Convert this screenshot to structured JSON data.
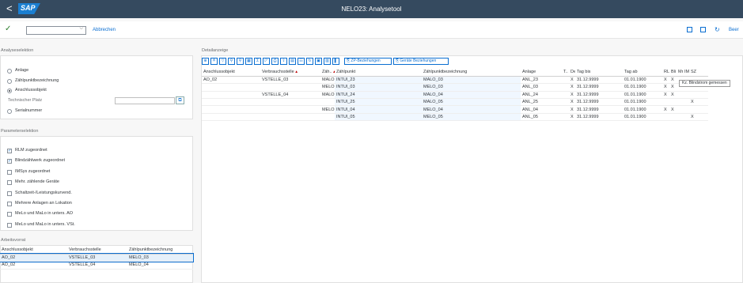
{
  "header": {
    "back": "<",
    "logo": "SAP",
    "title": "NELO23: Analysetool"
  },
  "toolbar": {
    "confirm": "✓",
    "command_value": "",
    "cancel_label": "Abbrechen",
    "right_label": "Beer"
  },
  "analyseselektion": {
    "title": "Analyseselektion",
    "options": [
      {
        "label": "Anlage",
        "selected": false
      },
      {
        "label": "Zählpunktbezeichnung",
        "selected": false
      },
      {
        "label": "Anschlussobjekt",
        "selected": true
      }
    ],
    "technischer_platz_label": "Technischer Platz",
    "technischer_platz_value": "",
    "serial_label": "Serialnummer"
  },
  "parameterselektion": {
    "title": "Parameterselektion",
    "checkboxes": [
      {
        "label": "RLM zugeordnet",
        "checked": true
      },
      {
        "label": "Blindzählwerk zugeordnet",
        "checked": true
      },
      {
        "label": "IMSys zugeordnet",
        "checked": false
      },
      {
        "label": "Mehr. zählende Geräte",
        "checked": false
      },
      {
        "label": "Schaltzeit-/Leistungskurvend.",
        "checked": false
      },
      {
        "label": "Mehrere Anlagen an Lokation",
        "checked": false
      },
      {
        "label": "MeLo und MaLo in unters. AO",
        "checked": false
      },
      {
        "label": "MeLo und MaLo in unters. VSt.",
        "checked": false
      }
    ]
  },
  "arbeitsvorrat": {
    "title": "Arbeitsvorrat",
    "columns": [
      "Anschlussobjekt",
      "Verbrauchsstelle",
      "Zählpunktbezeichnung"
    ],
    "rows": [
      [
        "AO_02",
        "VSTELLE_03",
        "MELO_03"
      ],
      [
        "AO_02",
        "VSTELLE_04",
        "MELO_04"
      ]
    ]
  },
  "detailanzeige": {
    "title": "Detailanzeige",
    "btn_zp": "ZP-Beziehungen",
    "btn_geraete": "Geräte Beziehungen",
    "columns": [
      "Anschlussobjekt",
      "Verbrauchsstelle",
      "Zäh..",
      "Zählpunkt",
      "Zählpunktbezeichnung",
      "Anlage",
      "T..",
      "De",
      "Tag bis",
      "Tag ab",
      "RL",
      "Bli",
      "Mr",
      "IM",
      "SZ"
    ],
    "rows": [
      [
        "AO_02",
        "VSTELLE_03",
        "MALO",
        "INTUI_23",
        "MALO_03",
        "ANL_23",
        "",
        "X",
        "31.12.9999",
        "01.01.1900",
        "X",
        "X",
        "",
        "",
        ""
      ],
      [
        "",
        "",
        "MELO",
        "INTUI_03",
        "MELO_03",
        "ANL_03",
        "",
        "X",
        "31.12.9999",
        "01.01.1900",
        "X",
        "X",
        "",
        "",
        ""
      ],
      [
        "",
        "VSTELLE_04",
        "MALO",
        "INTUI_24",
        "MALO_04",
        "ANL_24",
        "",
        "X",
        "31.12.9999",
        "01.01.1900",
        "X",
        "X",
        "",
        "",
        ""
      ],
      [
        "",
        "",
        "",
        "INTUI_25",
        "MALO_05",
        "ANL_25",
        "",
        "X",
        "31.12.9999",
        "01.01.1900",
        "",
        "",
        "",
        "",
        "X"
      ],
      [
        "",
        "",
        "MELO",
        "INTUI_04",
        "MELO_04",
        "ANL_04",
        "",
        "X",
        "31.12.9999",
        "01.01.1900",
        "X",
        "X",
        "",
        "",
        ""
      ],
      [
        "",
        "",
        "",
        "INTUI_05",
        "MELO_05",
        "ANL_05",
        "",
        "X",
        "31.12.9999",
        "01.01.1900",
        "",
        "",
        "",
        "",
        "X"
      ]
    ],
    "tooltip": "Kz. Blindstrom gemessen"
  },
  "colors": {
    "shell": "#354a5f",
    "accent": "#0a6ed1",
    "selection": "#e5f0fa"
  }
}
